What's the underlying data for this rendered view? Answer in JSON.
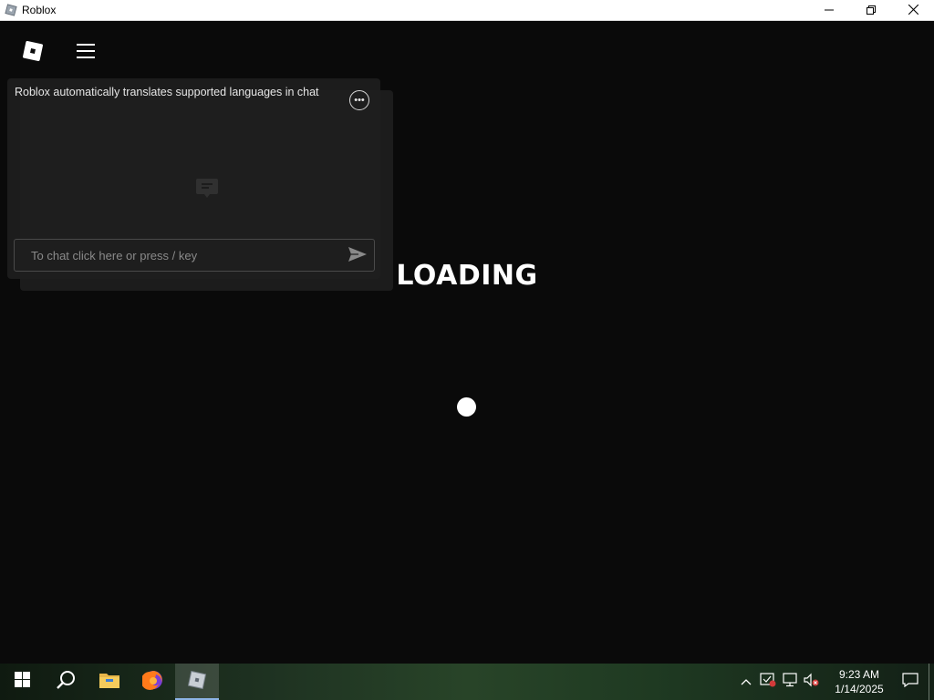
{
  "window": {
    "title": "Roblox",
    "app_icon": "roblox-icon",
    "controls": [
      "minimize-icon",
      "restore-icon",
      "close-icon"
    ]
  },
  "hud": {
    "buttons": [
      "roblox-logo-icon",
      "hamburger-menu-icon",
      "chat-bubble-icon"
    ]
  },
  "chat": {
    "system_message": "Roblox automatically translates supported languages in chat",
    "more_button": "•••",
    "input_placeholder": "To chat click here or press / key",
    "send_icon": "send-icon"
  },
  "loading": {
    "text": "LOADING"
  },
  "taskbar": {
    "start_icon": "windows-start-icon",
    "pinned": [
      "search-icon",
      "file-explorer-icon",
      "firefox-icon",
      "roblox-icon"
    ],
    "active_app": "roblox",
    "tray_icons": [
      "chevron-up-icon",
      "security-warning-icon",
      "network-icon",
      "volume-muted-icon"
    ],
    "time": "9:23 AM",
    "date": "1/14/2025",
    "notification_icon": "action-center-icon"
  },
  "colors": {
    "background": "#0b0b0b",
    "chat_panel": "#1e1e1e",
    "text": "#ffffff",
    "taskbar_accent": "#8db4e6"
  }
}
